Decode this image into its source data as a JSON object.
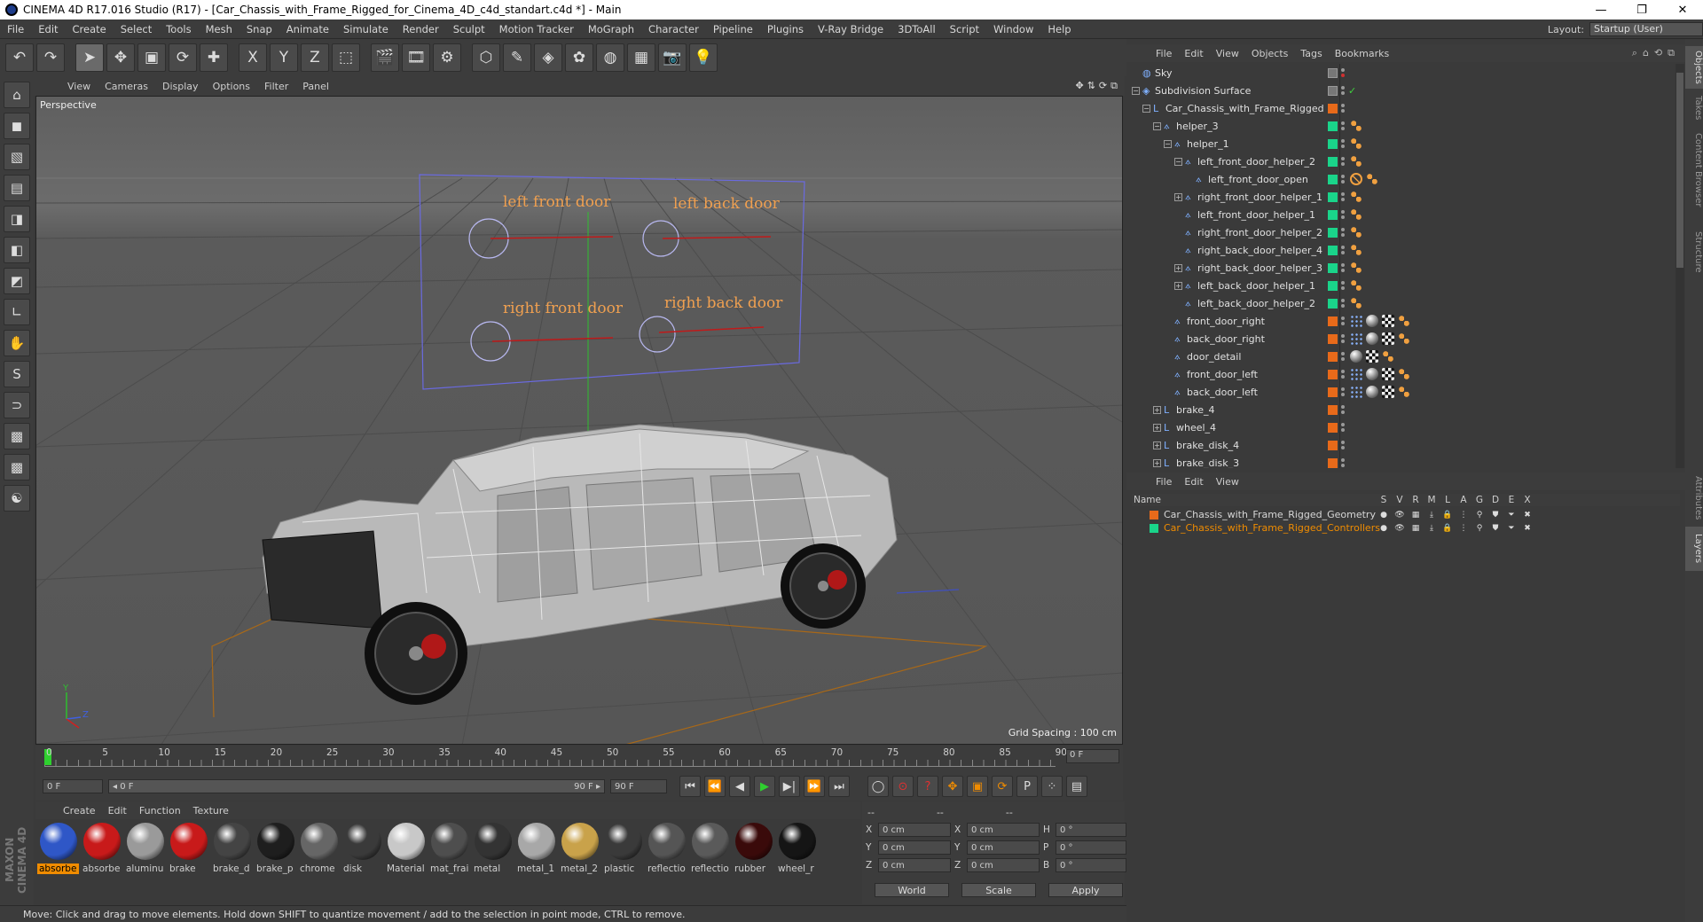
{
  "titlebar": {
    "title": "CINEMA 4D R17.016 Studio (R17) - [Car_Chassis_with_Frame_Rigged_for_Cinema_4D_c4d_standart.c4d *] - Main",
    "min": "—",
    "max": "❐",
    "close": "✕"
  },
  "menubar": {
    "items": [
      "File",
      "Edit",
      "Create",
      "Select",
      "Tools",
      "Mesh",
      "Snap",
      "Animate",
      "Simulate",
      "Render",
      "Sculpt",
      "Motion Tracker",
      "MoGraph",
      "Character",
      "Pipeline",
      "Plugins",
      "V-Ray Bridge",
      "3DToAll",
      "Script",
      "Window",
      "Help"
    ],
    "layout_label": "Layout:",
    "layout_value": "Startup (User)"
  },
  "toolbar": {
    "icons": [
      "undo-icon",
      "redo-icon",
      "select-icon",
      "move-icon",
      "scale-icon",
      "rotate-icon",
      "add-icon",
      "x-axis-icon",
      "y-axis-icon",
      "z-axis-icon",
      "coord-system-icon",
      "render-view-icon",
      "render-picture-viewer-icon",
      "render-settings-icon",
      "cube-icon",
      "pen-icon",
      "subdivision-icon",
      "cloner-icon",
      "deformer-icon",
      "floor-icon",
      "camera-icon",
      "light-icon"
    ],
    "glyphs": [
      "↶",
      "↷",
      "➤",
      "✥",
      "▣",
      "⟳",
      "✚",
      "X",
      "Y",
      "Z",
      "⬚",
      "🎬",
      "🎞",
      "⚙",
      "⬡",
      "✎",
      "◈",
      "✿",
      "◍",
      "▦",
      "📷",
      "💡"
    ]
  },
  "lefttoolbar": {
    "glyphs": [
      "⌂",
      "◼",
      "▧",
      "▤",
      "◨",
      "◧",
      "◩",
      "∟",
      "✋",
      "S",
      "⊃",
      "▩",
      "▩",
      "☯"
    ]
  },
  "maxon_logo": "MAXON CINEMA 4D",
  "viewport": {
    "menu": [
      "View",
      "Cameras",
      "Display",
      "Options",
      "Filter",
      "Panel"
    ],
    "nav_icons": [
      "✥",
      "⇅",
      "⟳",
      "⧉"
    ],
    "camera_label": "Perspective",
    "grid_spacing": "Grid Spacing : 100 cm",
    "labels": {
      "left_front_door": "left front door",
      "left_back_door": "left back door",
      "right_front_door": "right front door",
      "right_back_door": "right back door"
    },
    "axis": {
      "y": "Y",
      "z": "Z"
    }
  },
  "timeline": {
    "ticks": [
      "0",
      "5",
      "10",
      "15",
      "20",
      "25",
      "30",
      "35",
      "40",
      "45",
      "50",
      "55",
      "60",
      "65",
      "70",
      "75",
      "80",
      "85",
      "90"
    ],
    "current_frame": "0 F",
    "start_field": "0 F",
    "range_start": "◂ 0 F",
    "range_end": "90 F ▸",
    "end_field": "90 F",
    "playback_glyphs": [
      "⏮",
      "⏪",
      "◀",
      "▶",
      "▶|",
      "⏩",
      "⏭"
    ],
    "key_glyphs": [
      "◯",
      "⊙",
      "?",
      "✥",
      "▣",
      "⟳",
      "P",
      "⁘",
      "▤"
    ]
  },
  "material_manager": {
    "menu": [
      "Create",
      "Edit",
      "Function",
      "Texture"
    ],
    "materials": [
      {
        "label": "absorbe",
        "color": "#2f57c7",
        "selected": true
      },
      {
        "label": "absorbe",
        "color": "#c81a1a",
        "selected": false
      },
      {
        "label": "aluminu",
        "color": "#9a9a9a",
        "selected": false
      },
      {
        "label": "brake",
        "color": "#c81a1a",
        "selected": false
      },
      {
        "label": "brake_d",
        "color": "#444444",
        "selected": false
      },
      {
        "label": "brake_p",
        "color": "#1e1e1e",
        "selected": false
      },
      {
        "label": "chrome",
        "color": "#666666",
        "selected": false
      },
      {
        "label": "disk",
        "color": "#3a3a3a",
        "selected": false
      },
      {
        "label": "Material",
        "color": "#c8c8c8",
        "selected": false
      },
      {
        "label": "mat_frai",
        "color": "#4e4e4e",
        "selected": false
      },
      {
        "label": "metal",
        "color": "#333333",
        "selected": false
      },
      {
        "label": "metal_1",
        "color": "#a8a8a8",
        "selected": false
      },
      {
        "label": "metal_2",
        "color": "#c9a24a",
        "selected": false
      },
      {
        "label": "plastic",
        "color": "#3a3a3a",
        "selected": false
      },
      {
        "label": "reflectio",
        "color": "#555555",
        "selected": false
      },
      {
        "label": "reflectio",
        "color": "#5a5a5a",
        "selected": false
      },
      {
        "label": "rubber",
        "color": "#3a0a0a",
        "selected": false
      },
      {
        "label": "wheel_r",
        "color": "#151515",
        "selected": false
      }
    ]
  },
  "coord_manager": {
    "dash1": "--",
    "dash2": "--",
    "dash3": "--",
    "x_label": "X",
    "y_label": "Y",
    "z_label": "Z",
    "x2_label": "X",
    "y2_label": "Y",
    "z2_label": "Z",
    "h_label": "H",
    "p_label": "P",
    "b_label": "B",
    "x": "0 cm",
    "y": "0 cm",
    "z": "0 cm",
    "x2": "0 cm",
    "y2": "0 cm",
    "z2": "0 cm",
    "h": "0 °",
    "p": "0 °",
    "b": "0 °",
    "world": "World",
    "scale": "Scale",
    "apply": "Apply"
  },
  "statusbar": {
    "text": "Move: Click and drag to move elements. Hold down SHIFT to quantize movement / add to the selection in point mode, CTRL to remove."
  },
  "object_manager": {
    "menu": [
      "File",
      "Edit",
      "View",
      "Objects",
      "Tags",
      "Bookmarks"
    ],
    "icons": [
      "⌕",
      "⌂",
      "⟲",
      "⧉"
    ],
    "rows": [
      {
        "name": "Sky",
        "depth": 0,
        "expander": "",
        "icon": "sky-icon",
        "glyph": "◍",
        "layer": "",
        "tags": []
      },
      {
        "name": "Subdivision Surface",
        "depth": 0,
        "expander": "−",
        "icon": "subdivision-icon",
        "glyph": "◈",
        "layer": "",
        "tags": [],
        "check": "✓"
      },
      {
        "name": "Car_Chassis_with_Frame_Rigged",
        "depth": 1,
        "expander": "−",
        "icon": "null-icon",
        "glyph": "L",
        "layer": "#e86a1a",
        "tags": []
      },
      {
        "name": "helper_3",
        "depth": 2,
        "expander": "−",
        "icon": "joint-icon",
        "glyph": "⟑",
        "layer": "#1ad48a",
        "tags": [
          "orange"
        ]
      },
      {
        "name": "helper_1",
        "depth": 3,
        "expander": "−",
        "icon": "joint-icon",
        "glyph": "⟑",
        "layer": "#1ad48a",
        "tags": [
          "orange"
        ]
      },
      {
        "name": "left_front_door_helper_2",
        "depth": 4,
        "expander": "−",
        "icon": "joint-icon",
        "glyph": "⟑",
        "layer": "#1ad48a",
        "tags": [
          "orange"
        ]
      },
      {
        "name": "left_front_door_open",
        "depth": 5,
        "expander": "",
        "icon": "joint-icon",
        "glyph": "⟑",
        "layer": "#1ad48a",
        "tags": [
          "block",
          "orange"
        ]
      },
      {
        "name": "right_front_door_helper_1",
        "depth": 4,
        "expander": "+",
        "icon": "joint-icon",
        "glyph": "⟑",
        "layer": "#1ad48a",
        "tags": [
          "orange"
        ]
      },
      {
        "name": "left_front_door_helper_1",
        "depth": 4,
        "expander": "",
        "icon": "joint-icon",
        "glyph": "⟑",
        "layer": "#1ad48a",
        "tags": [
          "orange"
        ]
      },
      {
        "name": "right_front_door_helper_2",
        "depth": 4,
        "expander": "",
        "icon": "joint-icon",
        "glyph": "⟑",
        "layer": "#1ad48a",
        "tags": [
          "orange"
        ]
      },
      {
        "name": "right_back_door_helper_4",
        "depth": 4,
        "expander": "",
        "icon": "joint-icon",
        "glyph": "⟑",
        "layer": "#1ad48a",
        "tags": [
          "orange"
        ]
      },
      {
        "name": "right_back_door_helper_3",
        "depth": 4,
        "expander": "+",
        "icon": "joint-icon",
        "glyph": "⟑",
        "layer": "#1ad48a",
        "tags": [
          "orange"
        ]
      },
      {
        "name": "left_back_door_helper_1",
        "depth": 4,
        "expander": "+",
        "icon": "joint-icon",
        "glyph": "⟑",
        "layer": "#1ad48a",
        "tags": [
          "orange"
        ]
      },
      {
        "name": "left_back_door_helper_2",
        "depth": 4,
        "expander": "",
        "icon": "joint-icon",
        "glyph": "⟑",
        "layer": "#1ad48a",
        "tags": [
          "orange"
        ]
      },
      {
        "name": "front_door_right",
        "depth": 3,
        "expander": "",
        "icon": "joint-icon",
        "glyph": "⟑",
        "layer": "#e86a1a",
        "tags": [
          "dots",
          "sphere",
          "checker",
          "orange"
        ]
      },
      {
        "name": "back_door_right",
        "depth": 3,
        "expander": "",
        "icon": "joint-icon",
        "glyph": "⟑",
        "layer": "#e86a1a",
        "tags": [
          "dots",
          "sphere",
          "checker",
          "orange"
        ]
      },
      {
        "name": "door_detail",
        "depth": 3,
        "expander": "",
        "icon": "joint-icon",
        "glyph": "⟑",
        "layer": "#e86a1a",
        "tags": [
          "sphere",
          "checker",
          "orange"
        ]
      },
      {
        "name": "front_door_left",
        "depth": 3,
        "expander": "",
        "icon": "joint-icon",
        "glyph": "⟑",
        "layer": "#e86a1a",
        "tags": [
          "dots",
          "sphere",
          "checker",
          "orange"
        ]
      },
      {
        "name": "back_door_left",
        "depth": 3,
        "expander": "",
        "icon": "joint-icon",
        "glyph": "⟑",
        "layer": "#e86a1a",
        "tags": [
          "dots",
          "sphere",
          "checker",
          "orange"
        ]
      },
      {
        "name": "brake_4",
        "depth": 2,
        "expander": "+",
        "icon": "null-icon",
        "glyph": "L",
        "layer": "#e86a1a",
        "tags": []
      },
      {
        "name": "wheel_4",
        "depth": 2,
        "expander": "+",
        "icon": "null-icon",
        "glyph": "L",
        "layer": "#e86a1a",
        "tags": []
      },
      {
        "name": "brake_disk_4",
        "depth": 2,
        "expander": "+",
        "icon": "null-icon",
        "glyph": "L",
        "layer": "#e86a1a",
        "tags": []
      },
      {
        "name": "brake_disk_3",
        "depth": 2,
        "expander": "+",
        "icon": "null-icon",
        "glyph": "L",
        "layer": "#e86a1a",
        "tags": []
      }
    ]
  },
  "layer_manager": {
    "menu": [
      "File",
      "Edit",
      "View"
    ],
    "name_header": "Name",
    "col_headers": [
      "S",
      "V",
      "R",
      "M",
      "L",
      "A",
      "G",
      "D",
      "E",
      "X"
    ],
    "rows": [
      {
        "name": "Car_Chassis_with_Frame_Rigged_Geometry",
        "color": "#e86a1a",
        "text_color": "#d6d6d6"
      },
      {
        "name": "Car_Chassis_with_Frame_Rigged_Controllers",
        "color": "#1ad48a",
        "text_color": "#f08c00"
      }
    ],
    "row_glyphs": [
      "●",
      "👁",
      "▦",
      "⤓",
      "🔒",
      "⋮",
      "⚲",
      "⛊",
      "⏷",
      "✖"
    ]
  },
  "side_tabs": [
    "Objects",
    "Takes",
    "Content Browser",
    "Structure",
    "Attributes",
    "Layers"
  ],
  "colors": {
    "accent_orange": "#f08c00",
    "layer_green": "#1ad48a",
    "layer_orange": "#e86a1a"
  }
}
